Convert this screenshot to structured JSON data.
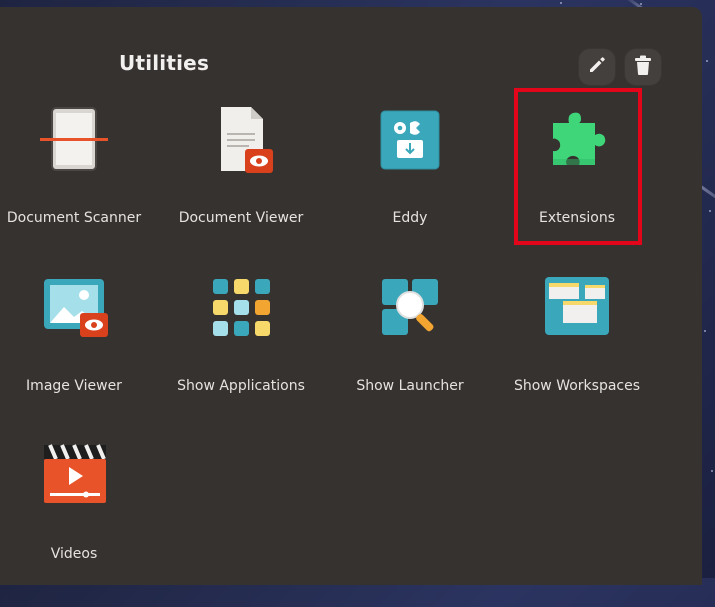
{
  "folder": {
    "title": "Utilities",
    "edit_icon": "pencil-icon",
    "delete_icon": "trash-icon"
  },
  "apps": [
    {
      "label": "Document Scanner",
      "icon": "scanner-icon"
    },
    {
      "label": "Document Viewer",
      "icon": "document-viewer-icon"
    },
    {
      "label": "Eddy",
      "icon": "eddy-package-icon"
    },
    {
      "label": "Extensions",
      "icon": "puzzle-piece-icon",
      "highlighted": true
    },
    {
      "label": "Image Viewer",
      "icon": "image-viewer-icon"
    },
    {
      "label": "Show Applications",
      "icon": "app-grid-icon"
    },
    {
      "label": "Show Launcher",
      "icon": "launcher-search-icon"
    },
    {
      "label": "Show Workspaces",
      "icon": "workspaces-icon"
    },
    {
      "label": "Videos",
      "icon": "video-clapper-icon"
    }
  ],
  "colors": {
    "panel": "#353230",
    "highlight": "#e3051a",
    "extensions_green": "#3fd67a",
    "accent_teal": "#4bbfd0",
    "accent_orange": "#e8532a"
  }
}
